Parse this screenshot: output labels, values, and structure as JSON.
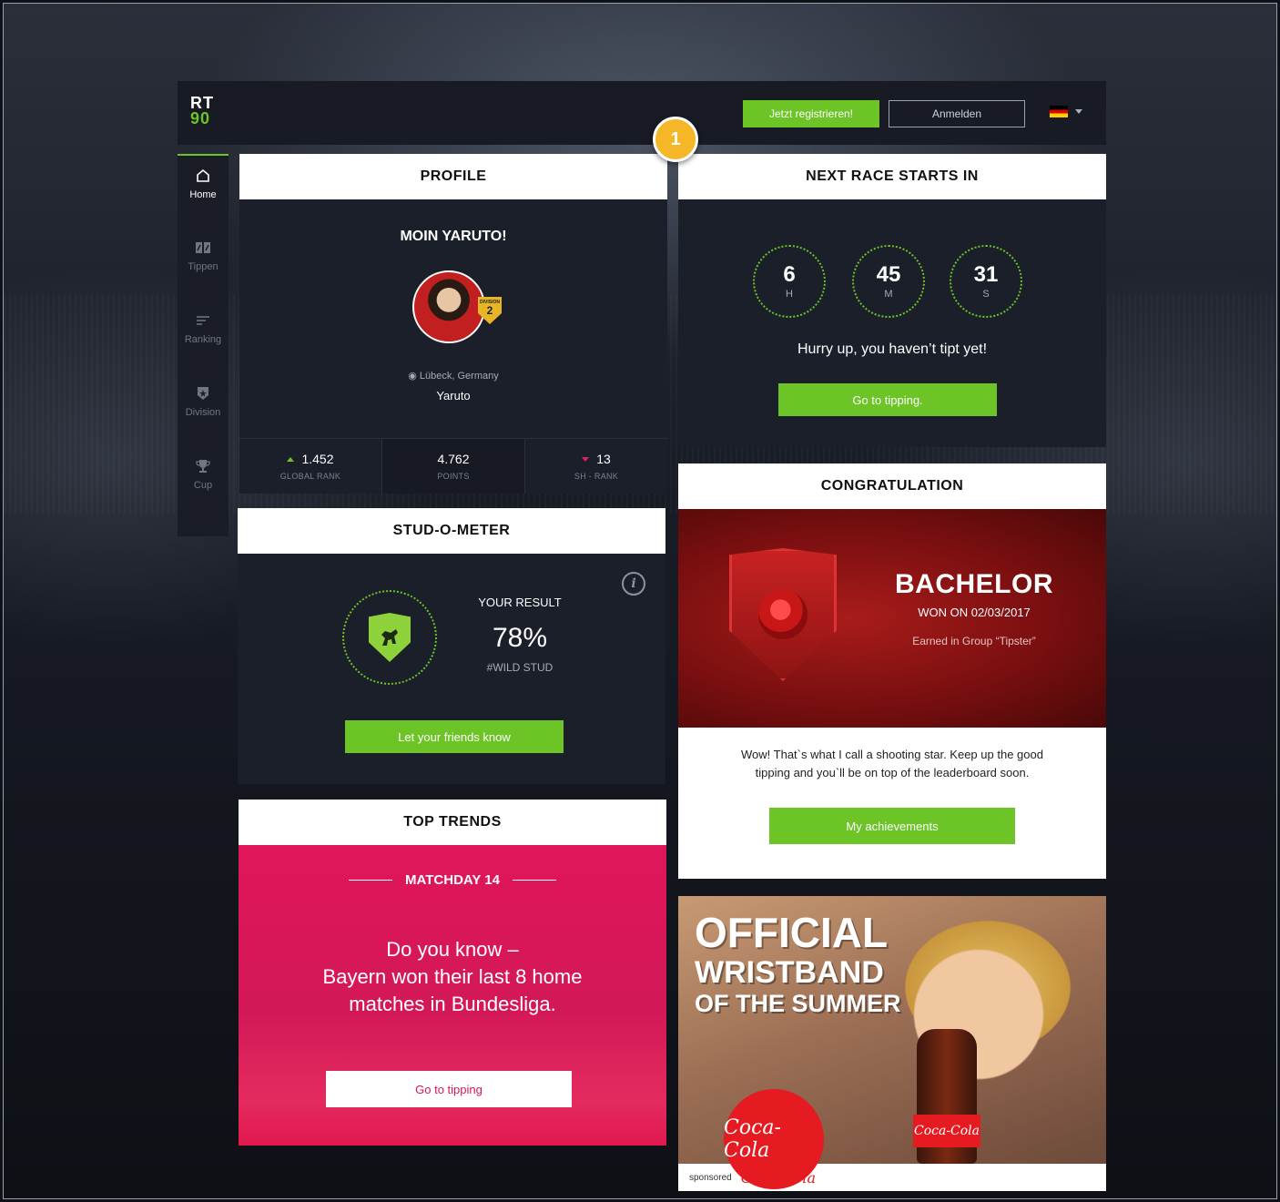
{
  "header": {
    "logo_line1": "RT",
    "logo_line2": "90",
    "register_label": "Jetzt registrieren!",
    "login_label": "Anmelden",
    "language_flag": "germany-flag-icon",
    "step_badge": "1"
  },
  "sidebar": {
    "items": [
      {
        "label": "Home",
        "icon": "home-icon"
      },
      {
        "label": "Tippen",
        "icon": "tippen-icon"
      },
      {
        "label": "Ranking",
        "icon": "ranking-icon"
      },
      {
        "label": "Division",
        "icon": "division-icon"
      },
      {
        "label": "Cup",
        "icon": "cup-icon"
      }
    ]
  },
  "profile": {
    "title": "PROFILE",
    "greeting": "MOIN YARUTO!",
    "division_label": "DIVISION",
    "division_number": "2",
    "location": "Lübeck, Germany",
    "username": "Yaruto",
    "stats": [
      {
        "value": "1.452",
        "label": "GLOBAL RANK",
        "trend": "up"
      },
      {
        "value": "4.762",
        "label": "POINTS",
        "trend": "none"
      },
      {
        "value": "13",
        "label": "SH - RANK",
        "trend": "down"
      }
    ]
  },
  "next_race": {
    "title": "NEXT RACE STARTS IN",
    "timers": [
      {
        "value": "6",
        "unit": "H"
      },
      {
        "value": "45",
        "unit": "M"
      },
      {
        "value": "31",
        "unit": "S"
      }
    ],
    "message": "Hurry up, you haven’t tipt yet!",
    "button_label": "Go to tipping."
  },
  "stud_o_meter": {
    "title": "STUD-O-METER",
    "info_icon": "i",
    "result_label": "YOUR RESULT",
    "result_value": "78%",
    "result_tag": "#WILD STUD",
    "button_label": "Let your friends know"
  },
  "top_trends": {
    "title": "TOP TRENDS",
    "matchday": "MATCHDAY 14",
    "fact_line1": "Do you know –",
    "fact_line2": "Bayern won their last 8 home",
    "fact_line3": "matches in Bundesliga.",
    "button_label": "Go to tipping"
  },
  "congratulation": {
    "title": "CONGRATULATION",
    "badge_name": "BACHELOR",
    "won_on": "WON ON 02/03/2017",
    "earned_in": "Earned in Group “Tipster”",
    "message_line1": "Wow! That`s what I call a shooting star. Keep up the good",
    "message_line2": "tipping and you`ll be on top of the leaderboard soon.",
    "button_label": "My achievements"
  },
  "ad": {
    "headline1": "OFFICIAL",
    "headline2": "WRISTBAND",
    "headline3": "OF THE SUMMER",
    "brand": "Coca-Cola",
    "sponsored_label": "sponsored"
  },
  "colors": {
    "accent_green": "#6cc427",
    "trend_pink": "#e0165a",
    "badge_red": "#a81c1a",
    "step_badge_yellow": "#f5b627"
  }
}
